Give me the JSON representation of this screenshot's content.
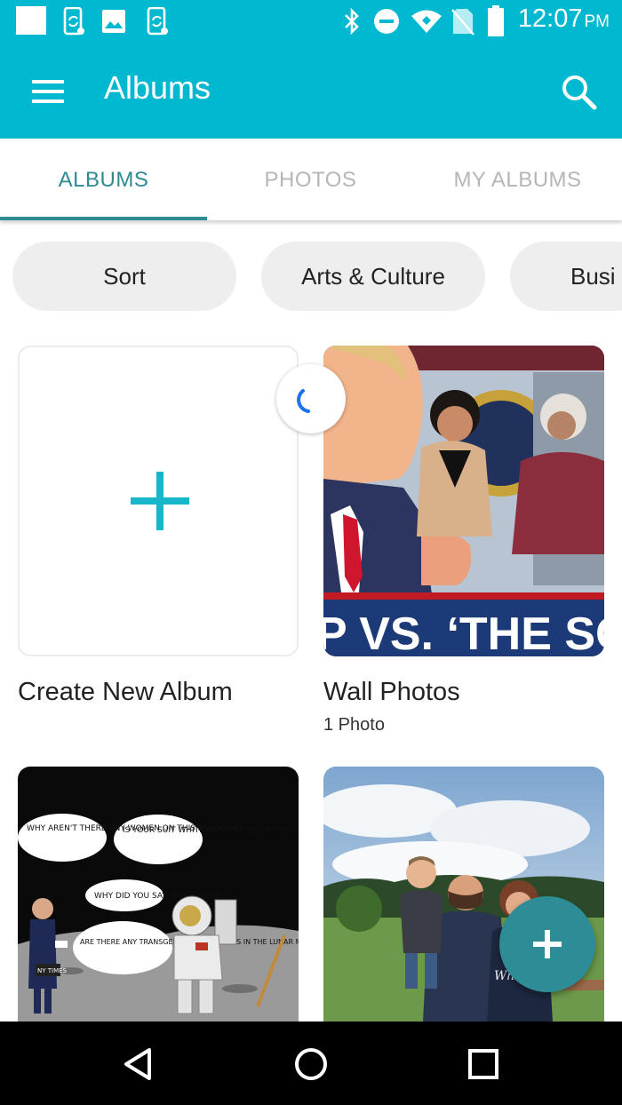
{
  "status_bar": {
    "time": "12:07",
    "ampm": "PM",
    "icons": [
      "white-square-icon",
      "phone-sync-icon",
      "image-icon",
      "phone-sync-icon",
      "bluetooth-icon",
      "do-not-disturb-icon",
      "wifi-icon",
      "no-sim-icon",
      "battery-icon"
    ]
  },
  "app_bar": {
    "title": "Albums",
    "menu_icon": "hamburger-menu-icon",
    "search_icon": "search-icon",
    "color": "#00b8d0"
  },
  "tabs": [
    {
      "label": "ALBUMS",
      "active": true
    },
    {
      "label": "PHOTOS",
      "active": false
    },
    {
      "label": "MY ALBUMS",
      "active": false
    }
  ],
  "chips": [
    {
      "label": "Sort"
    },
    {
      "label": "Arts & Culture"
    },
    {
      "label": "Busi"
    }
  ],
  "albums": [
    {
      "name": "Create New Album",
      "count": ""
    },
    {
      "name": "Wall Photos",
      "count": "1 Photo",
      "image_banner": "P VS. ‘THE SQ"
    },
    {
      "name": "",
      "count": ""
    },
    {
      "name": "",
      "count": ""
    }
  ],
  "cartoon": {
    "bubble1": "WHY AREN'T THERE ANY WOMEN ON THIS MISSION?",
    "bubble2": "IS YOUR SUIT WHITE BECAUSE YOU'RE RACIST?",
    "bubble3": "WHY DID YOU SAY \"MANKIND\"?",
    "bubble4": "ARE THERE ANY TRANSGENDER BATHROOMS IN THE LUNAR MODULE?",
    "badge": "NY TIMES"
  },
  "fab_icon": "add-icon",
  "colors": {
    "accent": "#00b8d0",
    "tab_active": "#2e8a93",
    "fab": "#2d8c95",
    "chip_bg": "#eeeeee"
  }
}
